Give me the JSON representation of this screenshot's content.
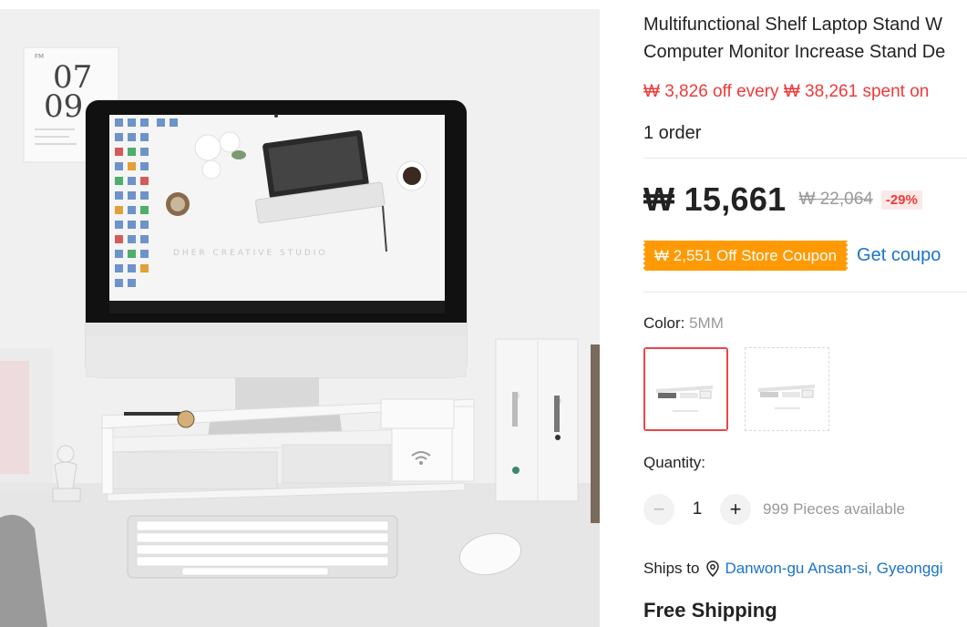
{
  "product": {
    "title_line1": "Multifunctional Shelf Laptop Stand W",
    "title_line2": "Computer Monitor Increase Stand De",
    "promo": "₩ 3,826 off every ₩ 38,261 spent on",
    "orders": "1 order",
    "price": "₩ 15,661",
    "original_price": "₩ 22,064",
    "discount": "-29%",
    "coupon_text": "₩ 2,551 Off Store Coupon",
    "get_coupon": "Get coupo",
    "color_label": "Color:",
    "color_value": "5MM",
    "quantity_label": "Quantity:",
    "quantity_value": "1",
    "minus": "−",
    "plus": "+",
    "available": "999 Pieces available",
    "ships_label": "Ships to",
    "ships_location": "Danwon-gu Ansan-si, Gyeonggi",
    "shipping": "Free Shipping"
  },
  "photo": {
    "calendar_month": "07",
    "calendar_day": "09",
    "calendar_corner": "FM"
  },
  "icons": {
    "location": "location-pin-icon"
  },
  "colors": {
    "price_red": "#ed3a3a",
    "coupon_orange": "#ff9a04",
    "link_blue": "#1a73c8",
    "selected_border": "#e8454b"
  }
}
